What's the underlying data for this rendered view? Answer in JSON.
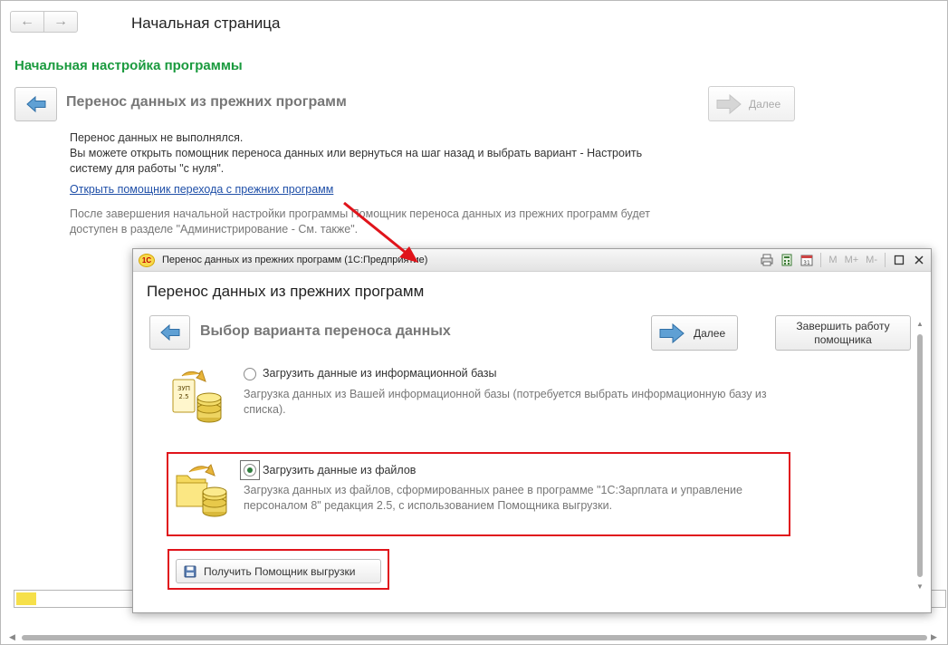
{
  "main": {
    "nav": {
      "back_glyph": "←",
      "forward_glyph": "→"
    },
    "home_title": "Начальная страница",
    "section_title": "Начальная настройка программы",
    "step_title": "Перенос данных из прежних программ",
    "next_label": "Далее",
    "para_lines": [
      "Перенос данных не выполнялся.",
      "Вы можете открыть помощник переноса данных или вернуться на шаг назад и выбрать вариант - Настроить",
      "систему для работы \"с нуля\"."
    ],
    "link_text": "Открыть помощник перехода с прежних программ",
    "note_text": "После завершения начальной настройки программы Помощник переноса данных из прежних программ будет доступен в разделе \"Администрирование - См. также\"."
  },
  "dialog": {
    "caption": "Перенос данных из прежних программ  (1С:Предприятие)",
    "logo_text": "1С",
    "toolbar": {
      "m": "M",
      "m_plus": "M+",
      "m_minus": "M-"
    },
    "heading": "Перенос данных из прежних программ",
    "step_title": "Выбор варианта переноса данных",
    "next_label": "Далее",
    "finish_label_1": "Завершить работу",
    "finish_label_2": "помощника",
    "options": [
      {
        "label": "Загрузить данные из информационной базы",
        "desc": "Загрузка данных из Вашей информационной базы (потребуется выбрать информационную базу из списка).",
        "selected": false,
        "badge_1": "ЗУП",
        "badge_2": "2.5"
      },
      {
        "label": "Загрузить данные из файлов",
        "desc": "Загрузка данных из файлов, сформированных ранее в программе \"1С:Зарплата и управление персоналом 8\" редакция 2.5, с использованием Помощника выгрузки.",
        "selected": true
      }
    ],
    "get_helper_label": "Получить Помощник выгрузки"
  },
  "colors": {
    "accent_green": "#1a9a3e",
    "highlight_red": "#e0141b",
    "link_blue": "#1f4fa8",
    "arrow_blue": "#4a90c8"
  },
  "icons": {
    "back": "arrow-left-icon",
    "next": "arrow-right-icon",
    "save": "floppy-disk-icon",
    "database": "database-stack-icon",
    "folder": "folder-icon"
  }
}
